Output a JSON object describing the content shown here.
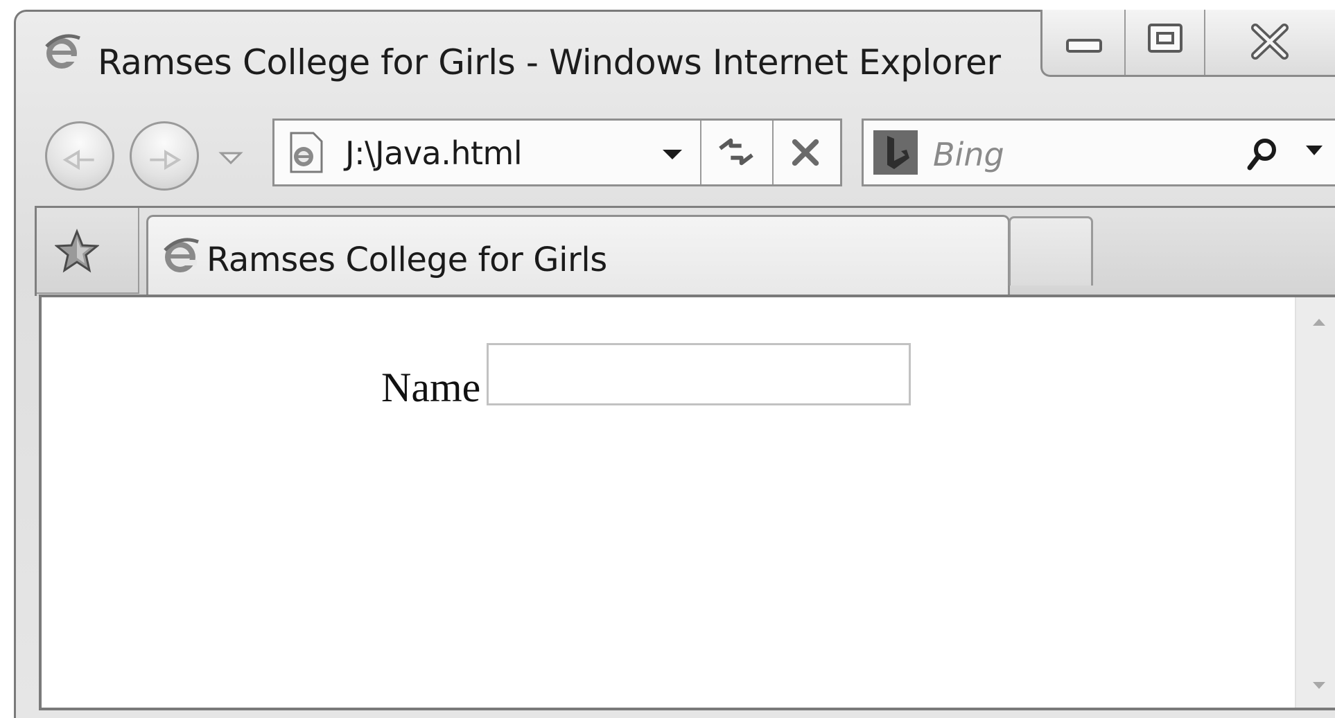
{
  "window": {
    "title": "Ramses College for Girls - Windows Internet Explorer"
  },
  "address_bar": {
    "url": "J:\\Java.html"
  },
  "search": {
    "placeholder": "Bing"
  },
  "tabs": [
    {
      "label": "Ramses College for Girls",
      "active": true
    }
  ],
  "page": {
    "name_label": "Name",
    "name_value": ""
  },
  "icons": {
    "app": "ie-logo-icon",
    "back": "back-arrow-icon",
    "forward": "forward-arrow-icon",
    "refresh": "refresh-icon",
    "stop": "stop-icon",
    "search": "magnifier-icon",
    "favorites": "star-icon",
    "provider": "bing-logo-icon"
  }
}
